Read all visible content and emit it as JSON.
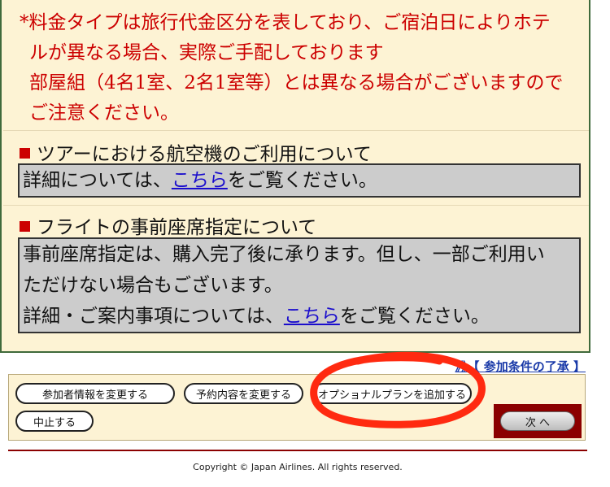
{
  "notice": {
    "lines": [
      "*料金タイプは旅行代金区分を表しており、ご宿泊日によりホテ",
      "ルが異なる場合、実際ご手配しております",
      "部屋組（4名1室、2名1室等）とは異なる場合がございますので",
      "ご注意ください。"
    ]
  },
  "sections": [
    {
      "heading": "ツアーにおける航空機のご利用について",
      "lines": [
        {
          "before": "詳細については、",
          "link": "こちら",
          "after": "をご覧ください。"
        }
      ]
    },
    {
      "heading": "フライトの事前座席指定について",
      "lines": [
        {
          "before": "事前座席指定は、購入完了後に承ります。但し、一部ご利用い",
          "link": "",
          "after": ""
        },
        {
          "before": "ただけない場合もございます。",
          "link": "",
          "after": ""
        },
        {
          "before": "詳細・ご案内事項については、",
          "link": "こちら",
          "after": "をご覧ください。"
        }
      ]
    }
  ],
  "agree_link": "》》【 参加条件の了承 】",
  "actions": {
    "change_participants": "参加者情報を変更する",
    "change_booking": "予約内容を変更する",
    "add_optional_plan": "オプショナルプランを追加する",
    "cancel": "中止する",
    "next": "次 へ"
  },
  "copyright": "Copyright © Japan Airlines. All rights reserved.",
  "colors": {
    "annotation": "#ff2a10",
    "accent_red": "#cc0000",
    "link": "#1a0dcc",
    "panel": "#fdf3d4"
  }
}
